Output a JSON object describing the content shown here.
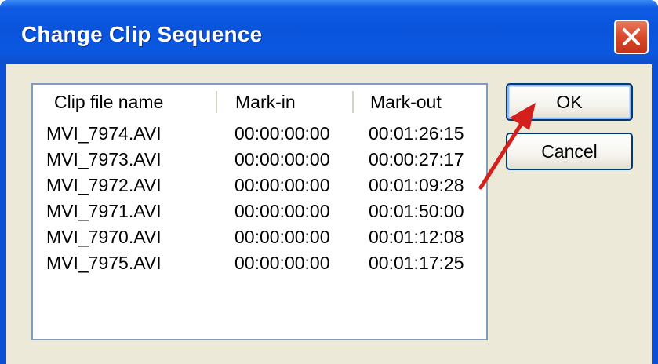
{
  "window": {
    "title": "Change Clip Sequence"
  },
  "clip_list": {
    "columns": [
      "Clip file name",
      "Mark-in",
      "Mark-out"
    ],
    "rows": [
      {
        "name": "MVI_7974.AVI",
        "mark_in": "00:00:00:00",
        "mark_out": "00:01:26:15"
      },
      {
        "name": "MVI_7973.AVI",
        "mark_in": "00:00:00:00",
        "mark_out": "00:00:27:17"
      },
      {
        "name": "MVI_7972.AVI",
        "mark_in": "00:00:00:00",
        "mark_out": "00:01:09:28"
      },
      {
        "name": "MVI_7971.AVI",
        "mark_in": "00:00:00:00",
        "mark_out": "00:01:50:00"
      },
      {
        "name": "MVI_7970.AVI",
        "mark_in": "00:00:00:00",
        "mark_out": "00:01:12:08"
      },
      {
        "name": "MVI_7975.AVI",
        "mark_in": "00:00:00:00",
        "mark_out": "00:01:17:25"
      }
    ]
  },
  "buttons": {
    "ok": "OK",
    "cancel": "Cancel"
  },
  "colors": {
    "title_bar": "#0a54dc",
    "dialog_face": "#ece9d8",
    "close_button": "#d9482a",
    "annotation_arrow": "#d4201c"
  },
  "icons": {
    "close": "close-icon",
    "annotation": "red-arrow-annotation"
  }
}
